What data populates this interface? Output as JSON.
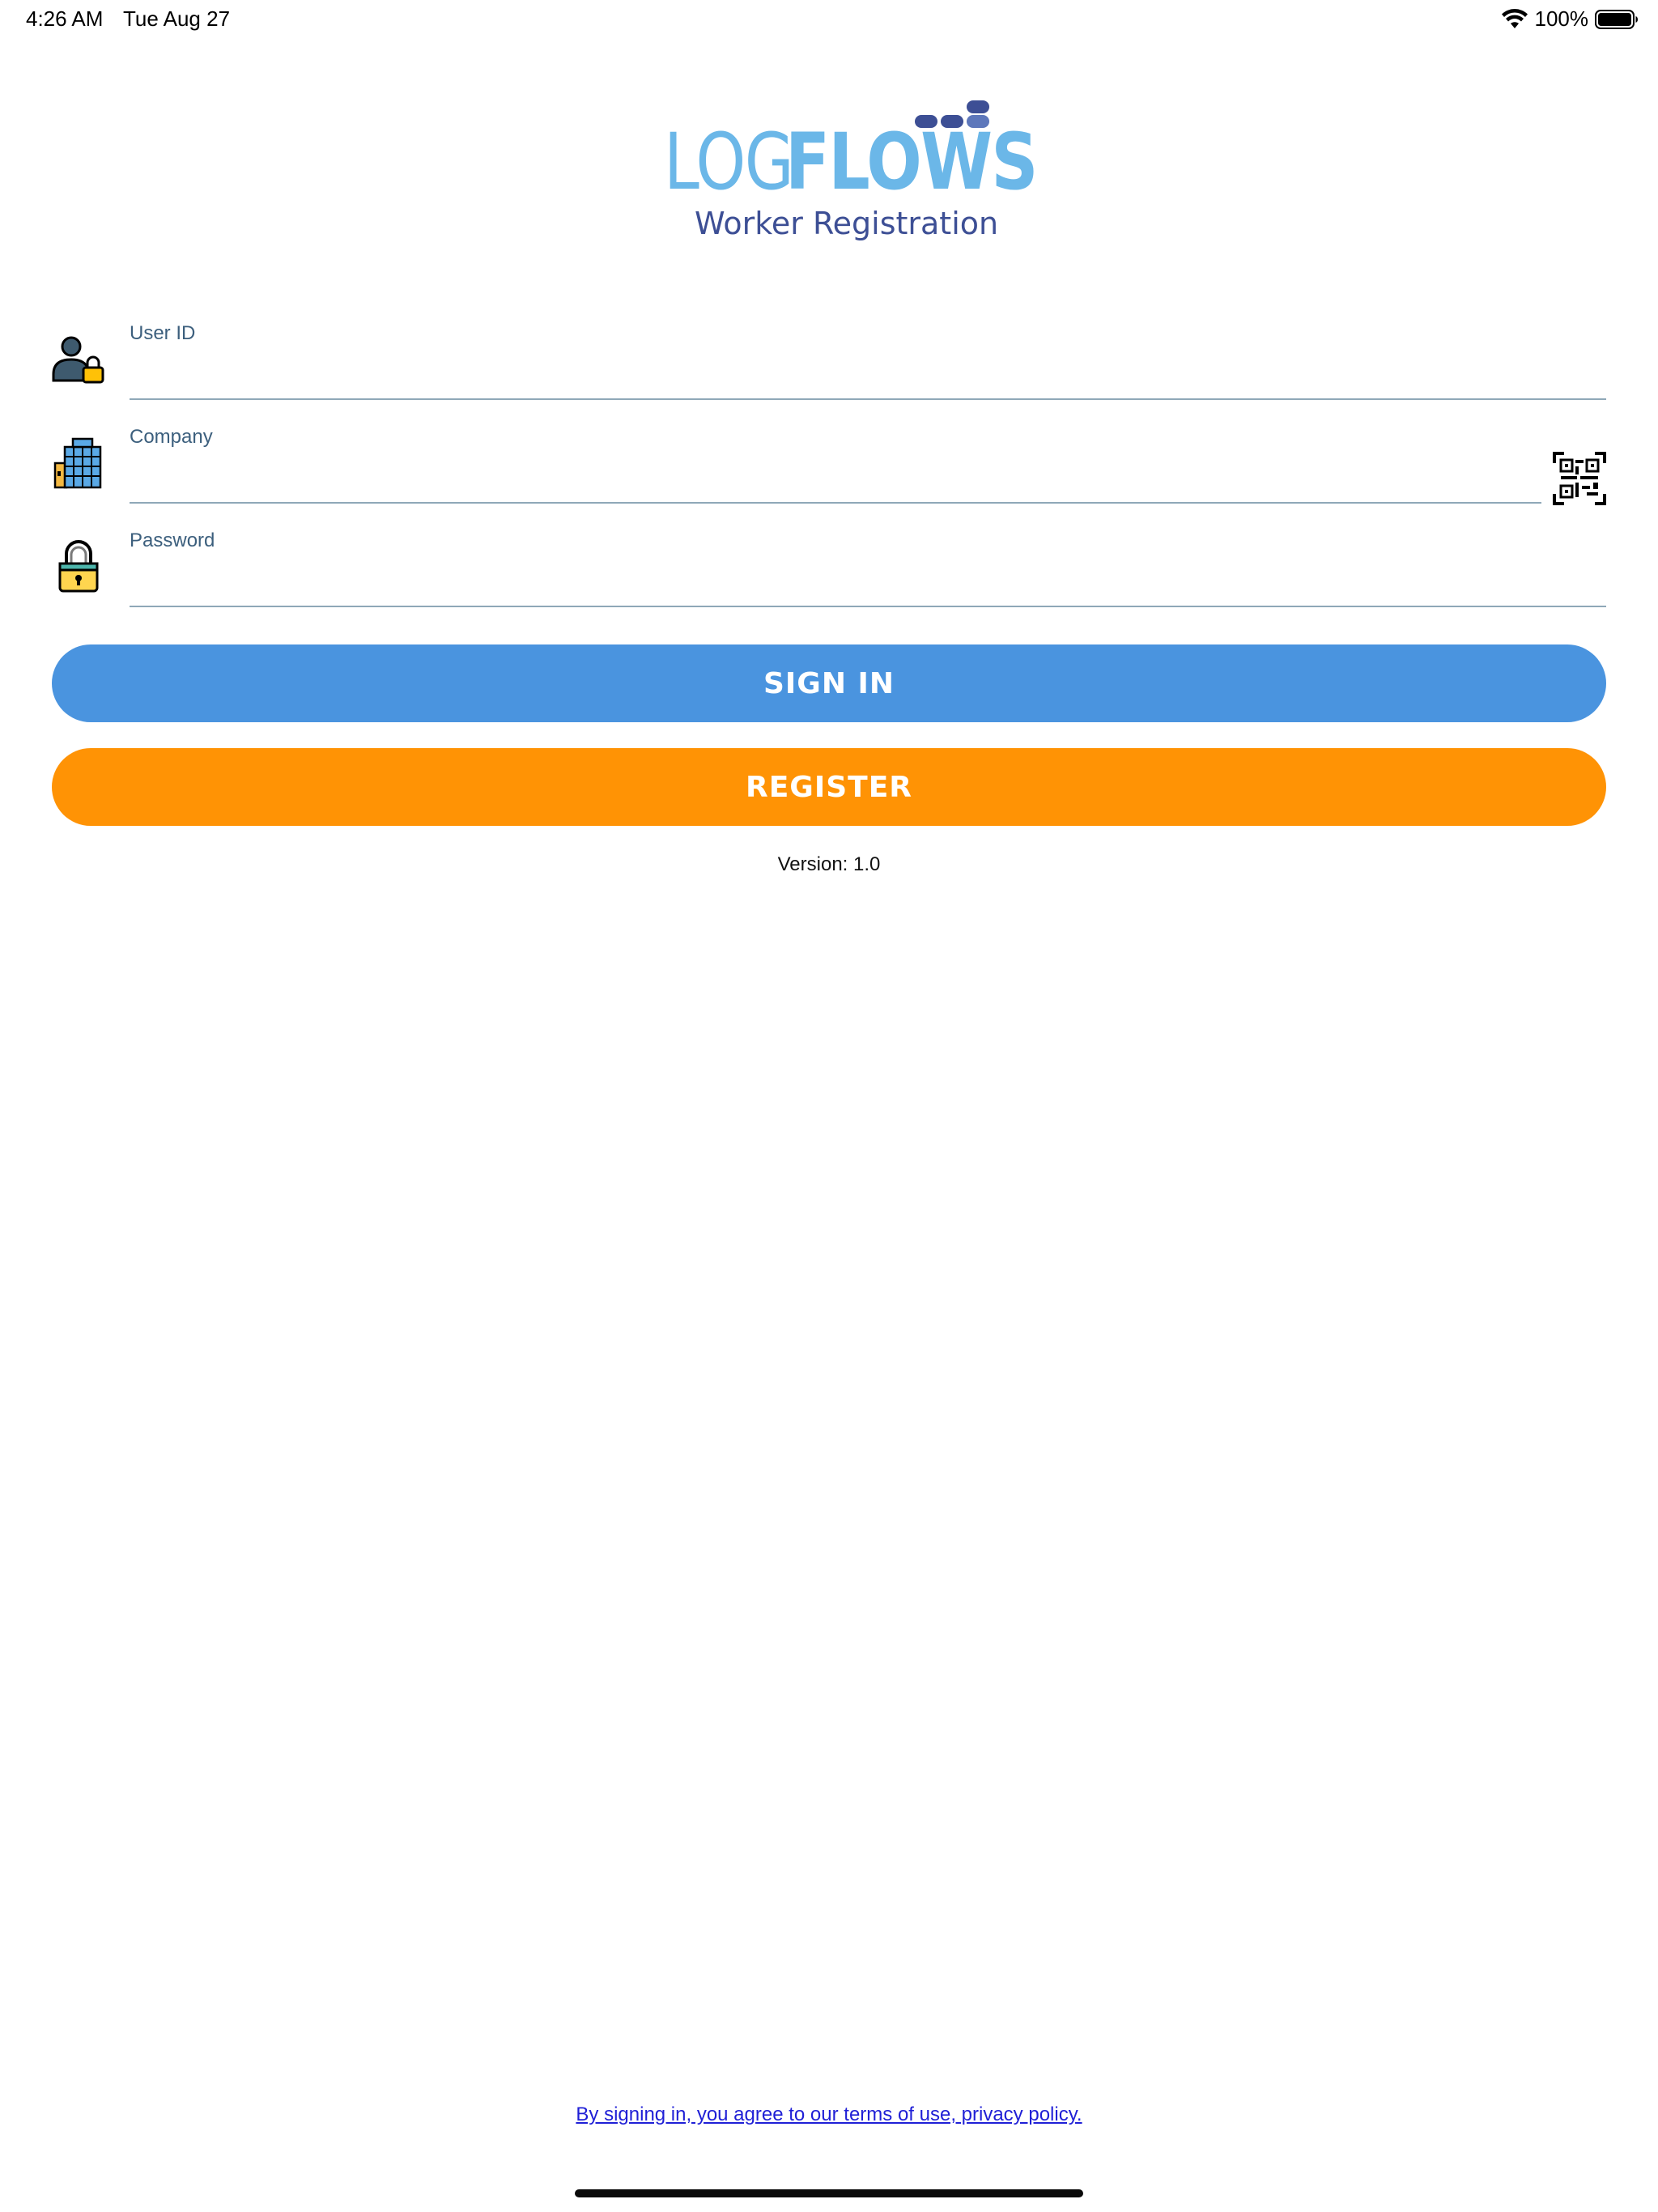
{
  "status_bar": {
    "time": "4:26 AM",
    "date": "Tue Aug 27",
    "battery_percent": "100%",
    "battery_level": 1.0,
    "icons": [
      "wifi-icon",
      "battery-icon"
    ]
  },
  "logo": {
    "word_part1": "LOG",
    "word_part2": "FLOWS",
    "subtitle": "Worker Registration",
    "colors": {
      "primary": "#6bb7e8",
      "dark": "#3d4f95",
      "mid": "#5d77bb"
    }
  },
  "form": {
    "user_id": {
      "label": "User ID",
      "value": "",
      "icon": "user-lock-icon"
    },
    "company": {
      "label": "Company",
      "value": "",
      "icon": "building-icon",
      "scan_icon": "qr-code-icon"
    },
    "password": {
      "label": "Password",
      "value": "",
      "icon": "padlock-icon"
    }
  },
  "buttons": {
    "sign_in": "SIGN IN",
    "register": "REGISTER",
    "colors": {
      "sign_in": "#4a94df",
      "register": "#ff9305"
    }
  },
  "version": "Version: 1.0",
  "terms": "By signing in, you agree to our terms of use, privacy policy."
}
